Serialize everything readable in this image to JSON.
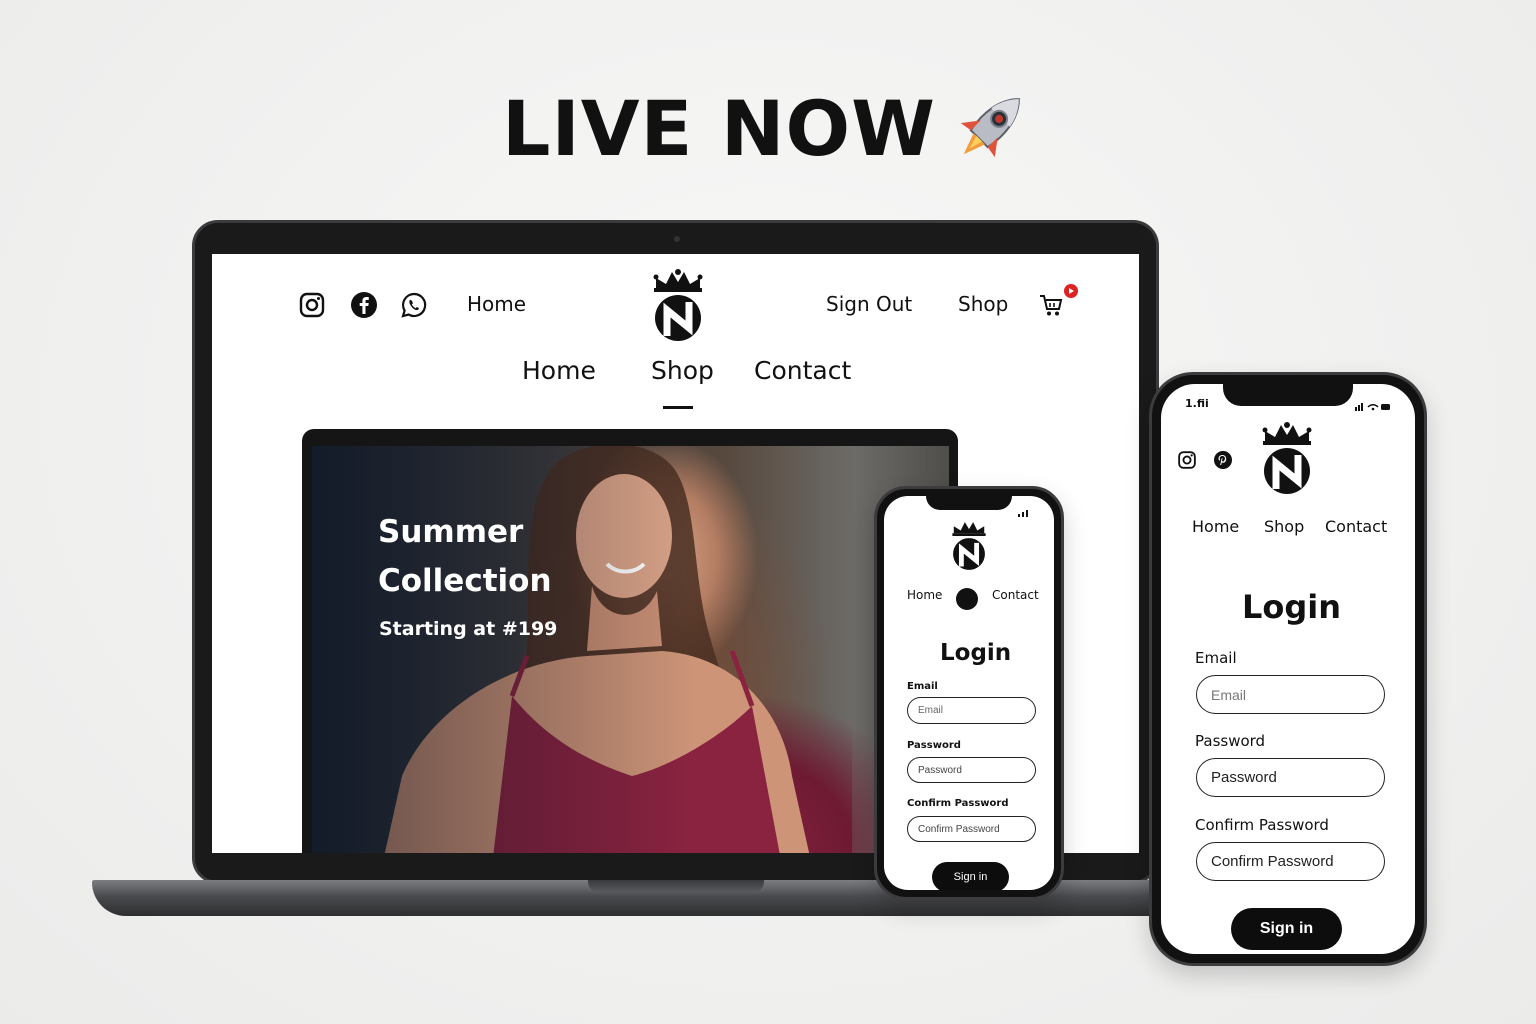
{
  "headline": {
    "text": "LIVE NOW",
    "icon": "rocket-icon"
  },
  "laptop_site": {
    "top_nav": {
      "social_icons": [
        "instagram-icon",
        "facebook-icon",
        "whatsapp-icon"
      ],
      "home": "Home",
      "sign_out": "Sign Out",
      "shop": "Shop",
      "cart_icon": "cart-icon"
    },
    "main_nav": {
      "home": "Home",
      "shop": "Shop",
      "contact": "Contact",
      "active": "Shop"
    },
    "hero": {
      "title_line1": "Summer",
      "title_line2": "Collection",
      "subtitle": "Starting at #199"
    }
  },
  "phone_small": {
    "nav": {
      "home": "Home",
      "contact": "Contact"
    },
    "login": {
      "title": "Login",
      "email_label": "Email",
      "email_placeholder": "Email",
      "password_label": "Password",
      "password_placeholder": "Password",
      "confirm_label": "Confirm Password",
      "confirm_placeholder": "Confirm Password",
      "submit": "Sign in"
    }
  },
  "phone_large": {
    "status": {
      "carrier": "1.fii"
    },
    "social_icons": [
      "instagram-icon",
      "pinterest-icon"
    ],
    "nav": {
      "home": "Home",
      "shop": "Shop",
      "contact": "Contact"
    },
    "login": {
      "title": "Login",
      "email_label": "Email",
      "email_placeholder": "Email",
      "password_label": "Password",
      "password_placeholder": "Password",
      "confirm_label": "Confirm Password",
      "confirm_placeholder": "Confirm Password",
      "submit": "Sign in"
    }
  },
  "colors": {
    "accent": "#0d0d0d",
    "background": "#efefee",
    "badge": "#dd2222",
    "hero_dress": "#8a2340"
  }
}
